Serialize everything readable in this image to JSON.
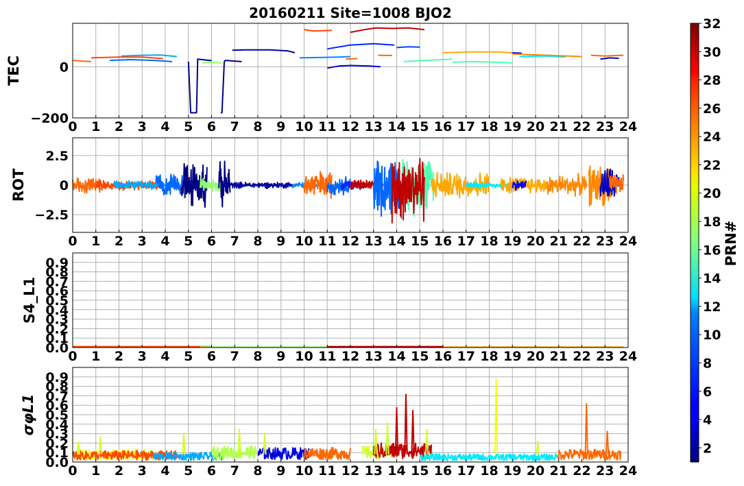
{
  "title": "20160211 Site=1008 BJO2",
  "chart_data": [
    {
      "type": "line",
      "ylabel": "TEC",
      "xlim": [
        0,
        24
      ],
      "ylim": [
        -200,
        170
      ],
      "yticks": [
        -200,
        0
      ],
      "xticks": [
        "0",
        "1",
        "2",
        "3",
        "4",
        "5",
        "6",
        "7",
        "8",
        "9",
        "10",
        "11",
        "12",
        "13",
        "14",
        "15",
        "16",
        "17",
        "18",
        "19",
        "20",
        "21",
        "22",
        "23",
        "24"
      ],
      "grid": true,
      "series": [
        {
          "prn": 1,
          "x": [
            5.0,
            5.1,
            5.15,
            5.35,
            5.4,
            5.9,
            6.0
          ],
          "y": [
            20,
            -180,
            -180,
            -180,
            30,
            25,
            25
          ]
        },
        {
          "prn": 1,
          "x": [
            6.4,
            6.45,
            6.55,
            6.6,
            7.3
          ],
          "y": [
            -180,
            -180,
            20,
            25,
            20
          ]
        },
        {
          "prn": 2,
          "x": [
            6.9,
            7.5,
            8.5,
            9.3,
            9.6
          ],
          "y": [
            65,
            66,
            66,
            62,
            55
          ]
        },
        {
          "prn": 4,
          "x": [
            11.0,
            11.5,
            12.0,
            12.8,
            13.3
          ],
          "y": [
            -5,
            3,
            5,
            3,
            0
          ]
        },
        {
          "prn": 3,
          "x": [
            22.8,
            23.2,
            23.6
          ],
          "y": [
            30,
            35,
            33
          ]
        },
        {
          "prn": 5,
          "x": [
            18.9,
            19.4
          ],
          "y": [
            55,
            53
          ]
        },
        {
          "prn": 6,
          "x": [
            11.0,
            12.0,
            13.0,
            13.9
          ],
          "y": [
            70,
            85,
            90,
            85
          ]
        },
        {
          "prn": 7,
          "x": [
            14.0,
            14.5,
            15.0
          ],
          "y": [
            75,
            78,
            77
          ]
        },
        {
          "prn": 8,
          "x": [
            1.6,
            2.5,
            3.5,
            4.3
          ],
          "y": [
            25,
            28,
            25,
            20
          ]
        },
        {
          "prn": 9,
          "x": [
            9.8,
            10.5,
            11.5,
            12.0
          ],
          "y": [
            35,
            36,
            38,
            40
          ]
        },
        {
          "prn": 10,
          "x": [
            2.1,
            3.0,
            3.8,
            4.5
          ],
          "y": [
            42,
            45,
            46,
            40
          ]
        },
        {
          "prn": 12,
          "x": [
            19.3,
            20.3,
            21.3
          ],
          "y": [
            40,
            42,
            38
          ]
        },
        {
          "prn": 15,
          "x": [
            14.3,
            15.2,
            16.0,
            16.4
          ],
          "y": [
            20,
            25,
            28,
            30
          ]
        },
        {
          "prn": 15,
          "x": [
            16.4,
            17.3,
            18.3,
            19.0
          ],
          "y": [
            18,
            20,
            18,
            15
          ]
        },
        {
          "prn": 17,
          "x": [
            5.6,
            6.0,
            6.4
          ],
          "y": [
            15,
            18,
            15
          ]
        },
        {
          "prn": 23,
          "x": [
            16.0,
            17.2,
            18.3,
            19.0
          ],
          "y": [
            55,
            58,
            58,
            55
          ]
        },
        {
          "prn": 24,
          "x": [
            19.0,
            20.5,
            22.0
          ],
          "y": [
            50,
            45,
            40
          ]
        },
        {
          "prn": 25,
          "x": [
            0.0,
            0.8
          ],
          "y": [
            25,
            20
          ]
        },
        {
          "prn": 25,
          "x": [
            11.8,
            12.3
          ],
          "y": [
            30,
            32
          ]
        },
        {
          "prn": 25,
          "x": [
            13.2,
            13.8
          ],
          "y": [
            45,
            44
          ]
        },
        {
          "prn": 25,
          "x": [
            22.4,
            23.0,
            23.8
          ],
          "y": [
            45,
            42,
            45
          ]
        },
        {
          "prn": 26,
          "x": [
            0.8,
            2.0,
            3.0,
            3.9
          ],
          "y": [
            35,
            38,
            38,
            32
          ]
        },
        {
          "prn": 26,
          "x": [
            10.0,
            10.4,
            11.2
          ],
          "y": [
            145,
            140,
            142
          ]
        },
        {
          "prn": 30,
          "x": [
            12.0,
            12.6,
            13.1,
            13.8,
            14.5,
            15.2
          ],
          "y": [
            135,
            145,
            152,
            150,
            152,
            145
          ]
        }
      ]
    },
    {
      "type": "line",
      "ylabel": "ROT",
      "xlim": [
        0,
        24
      ],
      "ylim": [
        -4,
        4
      ],
      "yticks": [
        -2.5,
        0.0,
        2.5
      ],
      "xticks": [
        "0",
        "1",
        "2",
        "3",
        "4",
        "5",
        "6",
        "7",
        "8",
        "9",
        "10",
        "11",
        "12",
        "13",
        "14",
        "15",
        "16",
        "17",
        "18",
        "19",
        "20",
        "21",
        "22",
        "23",
        "24"
      ],
      "grid": true,
      "series": [
        {
          "prn": 25,
          "t0": 0.0,
          "t1": 1.2,
          "amp": 0.8
        },
        {
          "prn": 26,
          "t0": 1.0,
          "t1": 3.8,
          "amp": 0.5
        },
        {
          "prn": 10,
          "t0": 1.8,
          "t1": 4.4,
          "amp": 0.4
        },
        {
          "prn": 8,
          "t0": 3.6,
          "t1": 5.2,
          "amp": 1.0
        },
        {
          "prn": 1,
          "t0": 4.7,
          "t1": 5.8,
          "amp": 2.2
        },
        {
          "prn": 17,
          "t0": 5.5,
          "t1": 6.5,
          "amp": 0.7
        },
        {
          "prn": 1,
          "t0": 6.3,
          "t1": 6.8,
          "amp": 2.2
        },
        {
          "prn": 2,
          "t0": 6.6,
          "t1": 9.5,
          "amp": 0.3
        },
        {
          "prn": 9,
          "t0": 9.5,
          "t1": 10.6,
          "amp": 0.3
        },
        {
          "prn": 25,
          "t0": 10.0,
          "t1": 11.2,
          "amp": 1.4
        },
        {
          "prn": 8,
          "t0": 11.0,
          "t1": 12.0,
          "amp": 0.9
        },
        {
          "prn": 6,
          "t0": 11.6,
          "t1": 12.6,
          "amp": 0.5
        },
        {
          "prn": 30,
          "t0": 12.0,
          "t1": 13.4,
          "amp": 0.5
        },
        {
          "prn": 8,
          "t0": 13.0,
          "t1": 14.2,
          "amp": 3.0
        },
        {
          "prn": 15,
          "t0": 14.2,
          "t1": 15.6,
          "amp": 2.8
        },
        {
          "prn": 30,
          "t0": 13.8,
          "t1": 15.2,
          "amp": 3.5
        },
        {
          "prn": 23,
          "t0": 15.5,
          "t1": 18.0,
          "amp": 1.3
        },
        {
          "prn": 12,
          "t0": 17.0,
          "t1": 19.5,
          "amp": 0.3
        },
        {
          "prn": 23,
          "t0": 18.5,
          "t1": 20.5,
          "amp": 0.8
        },
        {
          "prn": 5,
          "t0": 19.0,
          "t1": 19.6,
          "amp": 0.5
        },
        {
          "prn": 24,
          "t0": 20.5,
          "t1": 22.2,
          "amp": 1.0
        },
        {
          "prn": 24,
          "t0": 22.3,
          "t1": 23.3,
          "amp": 2.0
        },
        {
          "prn": 3,
          "t0": 22.8,
          "t1": 23.6,
          "amp": 1.8
        },
        {
          "prn": 25,
          "t0": 23.2,
          "t1": 23.8,
          "amp": 1.0
        }
      ]
    },
    {
      "type": "line",
      "ylabel": "S4_L1",
      "xlim": [
        0,
        24
      ],
      "ylim": [
        0,
        1.0
      ],
      "yticks": [
        "0.0",
        "0.1",
        "0.2",
        "0.3",
        "0.4",
        "0.5",
        "0.6",
        "0.7",
        "0.8",
        "0.9"
      ],
      "xticks": [
        "0",
        "1",
        "2",
        "3",
        "4",
        "5",
        "6",
        "7",
        "8",
        "9",
        "10",
        "11",
        "12",
        "13",
        "14",
        "15",
        "16",
        "17",
        "18",
        "19",
        "20",
        "21",
        "22",
        "23",
        "24"
      ],
      "grid": true,
      "series": [
        {
          "prn": 26,
          "t0": 0.0,
          "t1": 6.0,
          "level": 0.01
        },
        {
          "prn": 17,
          "t0": 5.5,
          "t1": 11.0,
          "level": 0.005
        },
        {
          "prn": 30,
          "t0": 11.0,
          "t1": 16.0,
          "level": 0.01
        },
        {
          "prn": 23,
          "t0": 16.0,
          "t1": 23.8,
          "level": 0.006
        }
      ]
    },
    {
      "type": "line",
      "ylabel": "σφL1",
      "xlim": [
        0,
        24
      ],
      "ylim": [
        0,
        1.0
      ],
      "yticks": [
        "0.0",
        "0.1",
        "0.2",
        "0.3",
        "0.4",
        "0.5",
        "0.6",
        "0.7",
        "0.8",
        "0.9"
      ],
      "xticks": [
        "0",
        "1",
        "2",
        "3",
        "4",
        "5",
        "6",
        "7",
        "8",
        "9",
        "10",
        "11",
        "12",
        "13",
        "14",
        "15",
        "16",
        "17",
        "18",
        "19",
        "20",
        "21",
        "22",
        "23",
        "24"
      ],
      "grid": true,
      "series": [
        {
          "prn": 20,
          "t0": 0.0,
          "t1": 3.5,
          "base": 0.08
        },
        {
          "prn": 26,
          "t0": 0.0,
          "t1": 4.5,
          "base": 0.07
        },
        {
          "prn": 10,
          "t0": 3.5,
          "t1": 6.5,
          "base": 0.06
        },
        {
          "prn": 18,
          "t0": 6.0,
          "t1": 8.0,
          "base": 0.1
        },
        {
          "prn": 4,
          "t0": 8.0,
          "t1": 10.2,
          "base": 0.09
        },
        {
          "prn": 25,
          "t0": 10.0,
          "t1": 12.0,
          "base": 0.09
        },
        {
          "prn": 19,
          "t0": 12.5,
          "t1": 14.0,
          "base": 0.1
        },
        {
          "prn": 30,
          "t0": 13.0,
          "t1": 15.5,
          "base": 0.12
        },
        {
          "prn": 12,
          "t0": 15.0,
          "t1": 21.0,
          "base": 0.05
        },
        {
          "prn": 25,
          "t0": 21.0,
          "t1": 23.7,
          "base": 0.08
        }
      ],
      "peaks": [
        {
          "x": 0.25,
          "y": 0.22
        },
        {
          "x": 1.2,
          "y": 0.27
        },
        {
          "x": 4.8,
          "y": 0.31
        },
        {
          "x": 7.2,
          "y": 0.35
        },
        {
          "x": 8.3,
          "y": 0.3
        },
        {
          "x": 13.1,
          "y": 0.35
        },
        {
          "x": 13.6,
          "y": 0.42
        },
        {
          "x": 14.0,
          "y": 0.58
        },
        {
          "x": 14.4,
          "y": 0.72
        },
        {
          "x": 14.7,
          "y": 0.55
        },
        {
          "x": 15.3,
          "y": 0.35
        },
        {
          "x": 18.3,
          "y": 0.88
        },
        {
          "x": 20.1,
          "y": 0.22
        },
        {
          "x": 22.2,
          "y": 0.62
        },
        {
          "x": 23.1,
          "y": 0.33
        }
      ]
    }
  ],
  "colorbar": {
    "label": "PRN#",
    "min": 1,
    "max": 32,
    "ticks": [
      "2",
      "4",
      "6",
      "8",
      "10",
      "12",
      "14",
      "16",
      "18",
      "20",
      "22",
      "24",
      "26",
      "28",
      "30",
      "32"
    ]
  }
}
